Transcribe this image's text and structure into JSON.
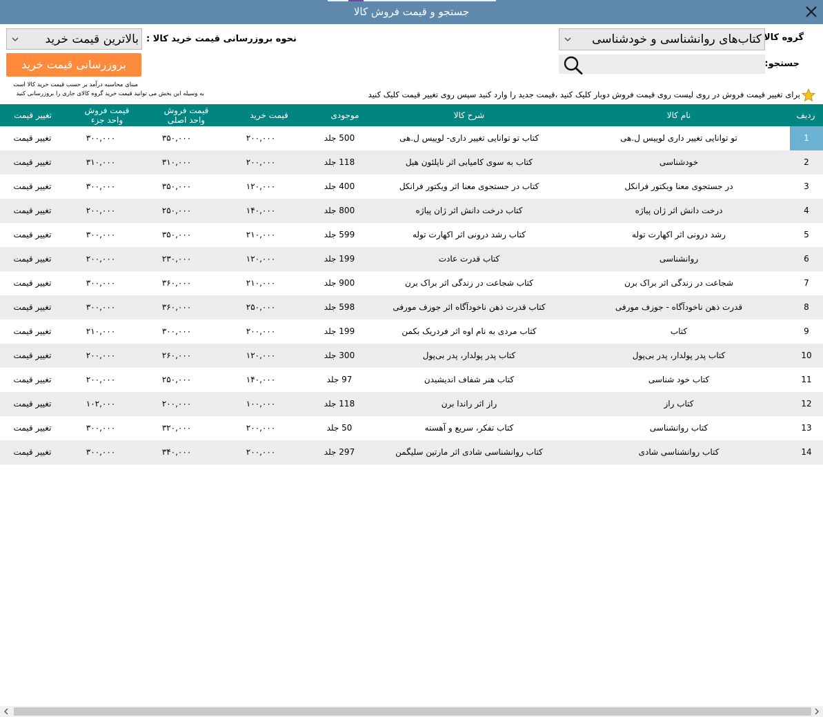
{
  "window": {
    "title": "جستجو و قیمت فروش کالا"
  },
  "filters": {
    "group_label": "گروه کالا:",
    "group_value": "کتاب‌های روانشناسی و خودشناسی",
    "search_label": "جستجو:",
    "search_value": "",
    "search_placeholder": "",
    "update_mode_label": "نحوه بروزرسانی قیمت خرید کالا :",
    "update_mode_value": "بالاترین قیمت خرید",
    "update_button": "بروزرسانی قیمت خرید",
    "note_line1": "مبنای محاسبه درآمد بر حسب قیمت خرید کالا است",
    "note_line2": "به وسیله این بخش می توانید قیمت خرید گروه کالای جاری را بروزرسانی کنید",
    "hint": "برای تغییر قیمت فروش در روی لیست روی قیمت فروش دوبار کلیک کنید ،قیمت جدید را وارد کنید سپس روی تغییر قیمت کلیک کنید"
  },
  "table": {
    "columns": {
      "row": "ردیف",
      "name": "نام کالا",
      "desc": "شرح کالا",
      "stock": "موجودی",
      "buy": "قیمت خرید",
      "sell_main_1": "قیمت فروش",
      "sell_main_2": "واحد اصلی",
      "sell_part_1": "قیمت فروش",
      "sell_part_2": "واحد جزء",
      "change": "تغییر قیمت"
    },
    "rows": [
      {
        "n": "1",
        "name": "تو توانایی تغییر داری لوییس ل.هی",
        "desc": "کتاب تو توانایی تغییر داری- لوییس ل.هی",
        "stock": "500 جلد",
        "buy": "۲۰۰,۰۰۰",
        "main": "۳۵۰,۰۰۰",
        "part": "۳۰۰,۰۰۰",
        "action": "تغییر قیمت"
      },
      {
        "n": "2",
        "name": "خودشناسی",
        "desc": "کتاب به سوی کامیابی اثر ناپلئون هیل",
        "stock": "118 جلد",
        "buy": "۲۰۰,۰۰۰",
        "main": "۳۱۰,۰۰۰",
        "part": "۳۱۰,۰۰۰",
        "action": "تغییر قیمت"
      },
      {
        "n": "3",
        "name": "در جستجوی معنا ویکتور فرانکل",
        "desc": "کتاب در جستجوی معنا اثر ویکتور فرانکل",
        "stock": "400 جلد",
        "buy": "۱۲۰,۰۰۰",
        "main": "۳۵۰,۰۰۰",
        "part": "۳۰۰,۰۰۰",
        "action": "تغییر قیمت"
      },
      {
        "n": "4",
        "name": "درخت دانش اثر ژان پیاژه",
        "desc": "کتاب درخت دانش اثر ژان پیاژه",
        "stock": "800 جلد",
        "buy": "۱۴۰,۰۰۰",
        "main": "۲۵۰,۰۰۰",
        "part": "۲۰۰,۰۰۰",
        "action": "تغییر قیمت"
      },
      {
        "n": "5",
        "name": "رشد درونی اثر اکهارت توله",
        "desc": "کتاب رشد درونی اثر  اکهارت توله",
        "stock": "599 جلد",
        "buy": "۲۱۰,۰۰۰",
        "main": "۳۵۰,۰۰۰",
        "part": "۳۰۰,۰۰۰",
        "action": "تغییر قیمت"
      },
      {
        "n": "6",
        "name": "روانشناسی",
        "desc": "کتاب قدرت عادت",
        "stock": "199 جلد",
        "buy": "۱۲۰,۰۰۰",
        "main": "۲۳۰,۰۰۰",
        "part": "۲۰۰,۰۰۰",
        "action": "تغییر قیمت"
      },
      {
        "n": "7",
        "name": "شجاعت در زندگی اثر براک برن",
        "desc": "کتاب شجاعت در زندگی اثر براک برن",
        "stock": "900 جلد",
        "buy": "۲۱۰,۰۰۰",
        "main": "۳۶۰,۰۰۰",
        "part": "۳۰۰,۰۰۰",
        "action": "تغییر قیمت"
      },
      {
        "n": "8",
        "name": "قدرت ذهن ناخودآگاه - جوزف مورفی",
        "desc": "کتاب قدرت ذهن ناخودآگاه اثر جوزف مورفی",
        "stock": "598 جلد",
        "buy": "۲۵۰,۰۰۰",
        "main": "۳۶۰,۰۰۰",
        "part": "۳۰۰,۰۰۰",
        "action": "تغییر قیمت"
      },
      {
        "n": "9",
        "name": "کتاب",
        "desc": "کتاب مردی به نام اوه اثر فردریک بکمن",
        "stock": "199 جلد",
        "buy": "۲۰۰,۰۰۰",
        "main": "۳۰۰,۰۰۰",
        "part": "۲۱۰,۰۰۰",
        "action": "تغییر قیمت"
      },
      {
        "n": "10",
        "name": "کتاب پدر پولدار، پدر بی‌پول",
        "desc": "کتاب پدر پولدار، پدر بی‌پول",
        "stock": "300 جلد",
        "buy": "۱۲۰,۰۰۰",
        "main": "۲۶۰,۰۰۰",
        "part": "۲۰۰,۰۰۰",
        "action": "تغییر قیمت"
      },
      {
        "n": "11",
        "name": "کتاب خود شناسی",
        "desc": "کتاب هنر شفاف اندیشیدن",
        "stock": "97 جلد",
        "buy": "۱۴۰,۰۰۰",
        "main": "۲۵۰,۰۰۰",
        "part": "۲۰۰,۰۰۰",
        "action": "تغییر قیمت"
      },
      {
        "n": "12",
        "name": "کتاب راز",
        "desc": "راز اثر راندا برن",
        "stock": "118 جلد",
        "buy": "۱۰۰,۰۰۰",
        "main": "۲۰۰,۰۰۰",
        "part": "۱۰۲,۰۰۰",
        "action": "تغییر قیمت"
      },
      {
        "n": "13",
        "name": "کتاب روانشناسی",
        "desc": "کتاب تفکر، سریع و آهسته",
        "stock": "50 جلد",
        "buy": "۲۰۰,۰۰۰",
        "main": "۳۲۰,۰۰۰",
        "part": "۳۰۰,۰۰۰",
        "action": "تغییر قیمت"
      },
      {
        "n": "14",
        "name": "کتاب روانشناسی شادی",
        "desc": "کتاب روانشناسی شادی اثر مارتین سلیگمن",
        "stock": "297 جلد",
        "buy": "۲۰۰,۰۰۰",
        "main": "۳۴۰,۰۰۰",
        "part": "۳۰۰,۰۰۰",
        "action": "تغییر قیمت"
      }
    ]
  },
  "colors": {
    "titlebar": "#5f88ad",
    "header": "#008580",
    "accent_button": "#ff8a3c",
    "selected_row_cell": "#6bb1d1",
    "alt_row": "#ececec"
  },
  "icons": {
    "close": "close-icon",
    "search": "search-icon",
    "star": "star-icon",
    "dropdown": "chevron-down-icon"
  }
}
